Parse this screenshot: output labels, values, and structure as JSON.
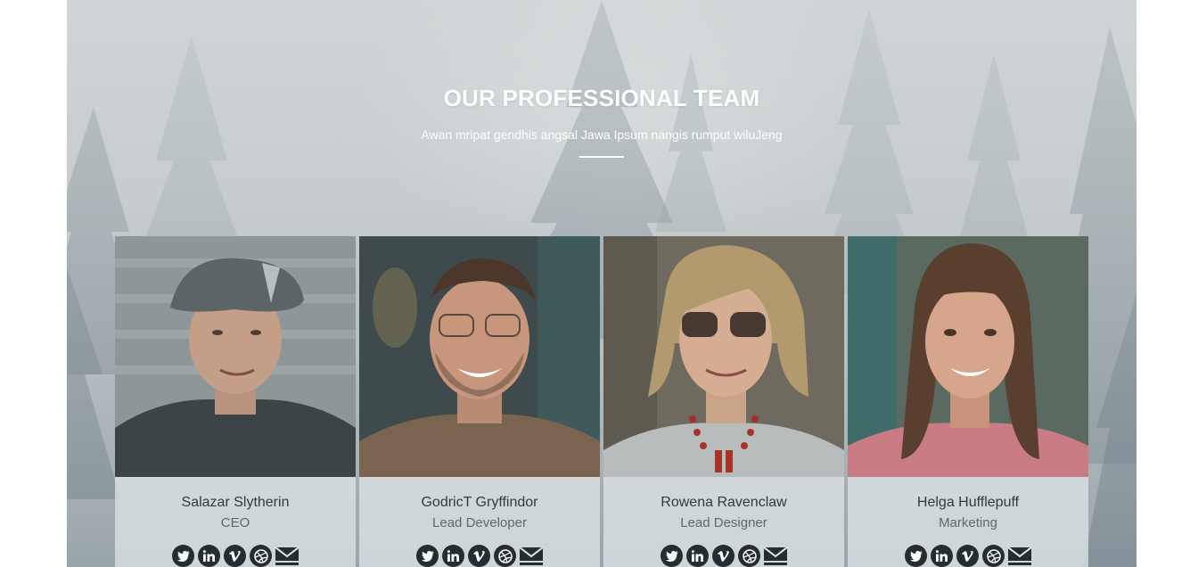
{
  "section": {
    "title": "OUR PROFESSIONAL TEAM",
    "subtitle": "Awan mripat gendhis angsal Jawa Ipsum nangis rumput wiluJeng"
  },
  "team": [
    {
      "name": "Salazar Slytherin",
      "role": "CEO",
      "socials": [
        "twitter-icon",
        "linkedin-icon",
        "vimeo-icon",
        "dribbble-icon",
        "email-icon"
      ]
    },
    {
      "name": "GodricT Gryffindor",
      "role": "Lead Developer",
      "socials": [
        "twitter-icon",
        "linkedin-icon",
        "vimeo-icon",
        "dribbble-icon",
        "email-icon"
      ]
    },
    {
      "name": "Rowena Ravenclaw",
      "role": "Lead Designer",
      "socials": [
        "twitter-icon",
        "linkedin-icon",
        "vimeo-icon",
        "dribbble-icon",
        "email-icon"
      ]
    },
    {
      "name": "Helga Hufflepuff",
      "role": "Marketing",
      "socials": [
        "twitter-icon",
        "linkedin-icon",
        "vimeo-icon",
        "dribbble-icon",
        "email-icon"
      ]
    }
  ],
  "colors": {
    "title": "#ffffff",
    "icon_bg": "#252d33",
    "name_text": "#2f3b42",
    "role_text": "#5d686e"
  }
}
